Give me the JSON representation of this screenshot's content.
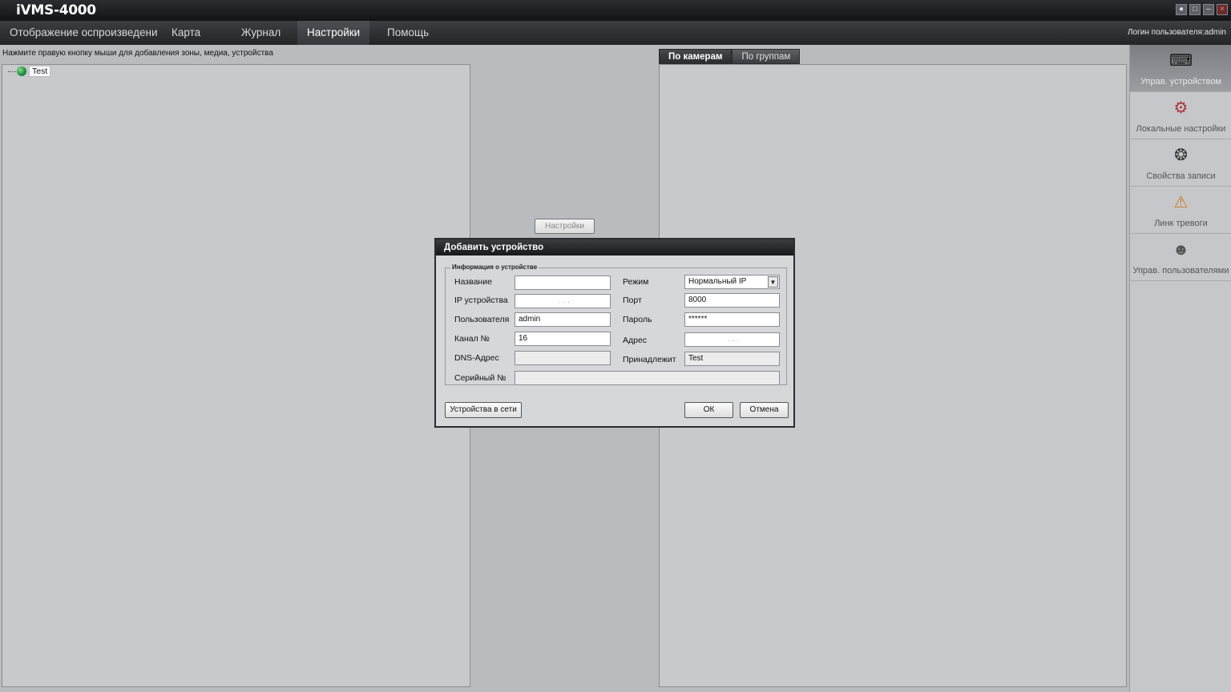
{
  "app": {
    "title": "iVMS-4000"
  },
  "menu": {
    "items": [
      "Отображение оспроизведени",
      "Карта",
      "Журнал",
      "Настройки",
      "Помощь"
    ],
    "login_info": "Логин пользователя:admin"
  },
  "hint": "Нажмите правую кнопку мыши для добавления зоны, медиа, устройства",
  "tree": {
    "root_label": "Test"
  },
  "tabs": [
    "По камерам",
    "По группам"
  ],
  "settings_button": "Настройки",
  "sidebar": {
    "items": [
      {
        "label": "Управ. устройством",
        "icon": "device-manager-icon"
      },
      {
        "label": "Локальные настройки",
        "icon": "local-settings-icon"
      },
      {
        "label": "Свойства записи",
        "icon": "record-properties-icon"
      },
      {
        "label": "Линк тревоги",
        "icon": "alarm-link-icon"
      },
      {
        "label": "Управ. пользователями",
        "icon": "user-manager-icon"
      }
    ]
  },
  "dialog": {
    "title": "Добавить устройство",
    "group_title": "Информация о устройстве",
    "labels": {
      "name": "Название",
      "ip": "IP устройства",
      "user": "Пользователя",
      "channel": "Канал №",
      "dns": "DNS-Адрес",
      "serial": "Серийный №",
      "mode": "Режим",
      "port": "Порт",
      "password": "Пароль",
      "address": "Адрес",
      "belongs": "Принадлежит"
    },
    "values": {
      "name": "",
      "ip": ".        .        .",
      "user": "admin",
      "channel": "16",
      "dns": "",
      "serial": "",
      "mode": "Нормальный IP",
      "port": "8000",
      "password": "******",
      "address": ".        .        .",
      "belongs": "Test"
    },
    "buttons": {
      "online_devices": "Устройства в сети",
      "ok": "ОК",
      "cancel": "Отмена"
    }
  }
}
